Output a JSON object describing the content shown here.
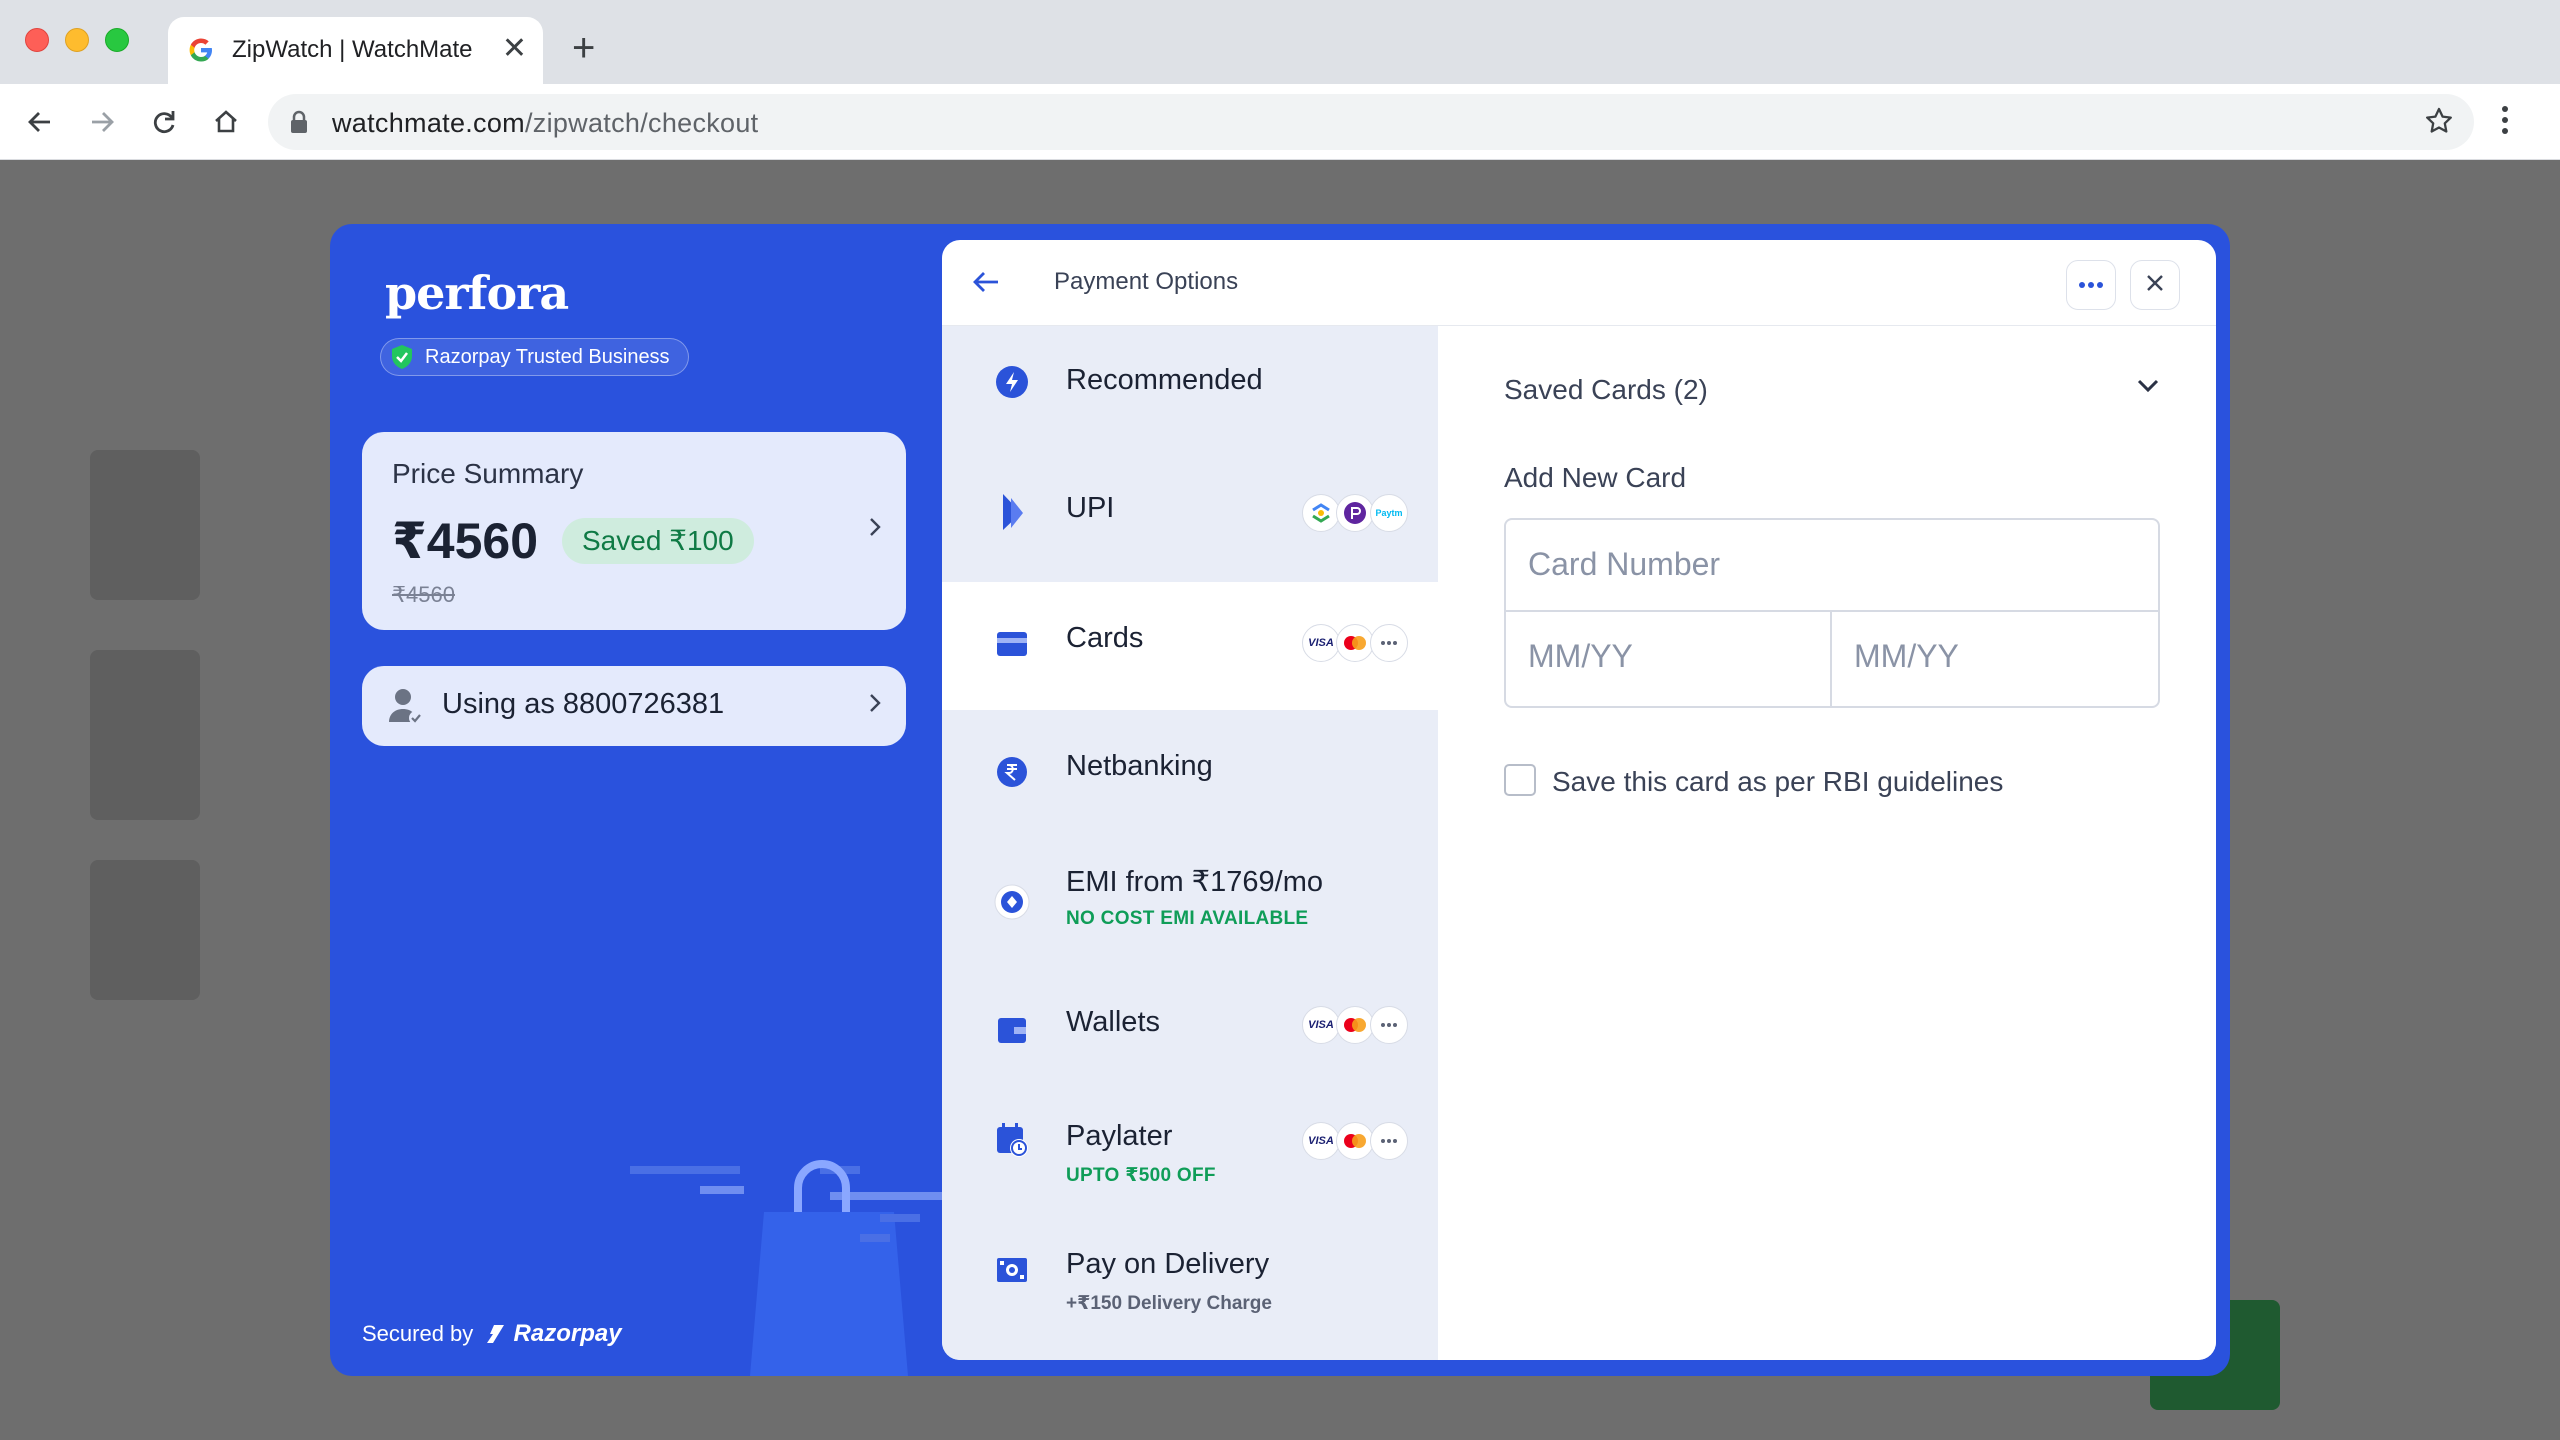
{
  "browser": {
    "tab_title": "ZipWatch | WatchMate",
    "url_host": "watchmate.com",
    "url_path": "/zipwatch/checkout"
  },
  "merchant": {
    "name": "perfora",
    "trust_badge": "Razorpay Trusted Business"
  },
  "price_summary": {
    "label": "Price Summary",
    "amount": "₹4560",
    "saved": "Saved ₹100",
    "original": "₹4560"
  },
  "user": {
    "label": "Using as 8800726381"
  },
  "footer": {
    "secured_by": "Secured by",
    "provider": "Razorpay"
  },
  "panel": {
    "title": "Payment Options"
  },
  "methods": [
    {
      "label": "Recommended",
      "sub": "",
      "icon": "bolt-icon"
    },
    {
      "label": "UPI",
      "sub": "",
      "icon": "upi-icon",
      "logos": [
        "gpay-logo",
        "phonepe-logo",
        "paytm-logo"
      ]
    },
    {
      "label": "Cards",
      "sub": "",
      "icon": "card-icon",
      "logos": [
        "VISA",
        "mastercard-logo",
        "more"
      ]
    },
    {
      "label": "Netbanking",
      "sub": "",
      "icon": "rupee-icon"
    },
    {
      "label": "EMI from ₹1769/mo",
      "sub": "NO COST EMI AVAILABLE",
      "icon": "emi-icon"
    },
    {
      "label": "Wallets",
      "sub": "",
      "icon": "wallet-icon",
      "logos": [
        "VISA",
        "mastercard-logo",
        "more"
      ]
    },
    {
      "label": "Paylater",
      "sub": "UPTO ₹500 OFF",
      "icon": "calendar-clock-icon",
      "logos": [
        "VISA",
        "mastercard-logo",
        "more"
      ]
    },
    {
      "label": "Pay on Delivery",
      "sub": "+₹150 Delivery Charge",
      "icon": "cash-icon"
    }
  ],
  "cards_form": {
    "saved_cards": "Saved Cards (2)",
    "add_new": "Add New Card",
    "card_number_placeholder": "Card Number",
    "expiry_placeholder": "MM/YY",
    "cvv_placeholder": "MM/YY",
    "save_card_label": "Save this card as per RBI guidelines",
    "save_card_checked": false
  },
  "logo_text": {
    "visa": "VISA",
    "paytm": "Paytm"
  },
  "colors": {
    "brand_blue": "#2a52dd",
    "accent_green": "#0f9d58",
    "method_icon": "#2b53d9"
  }
}
